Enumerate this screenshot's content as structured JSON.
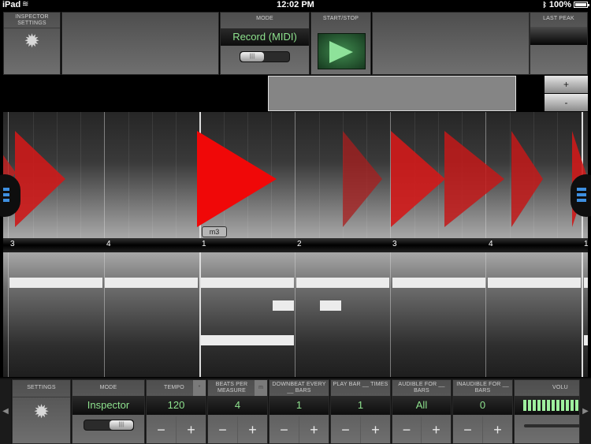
{
  "status_bar": {
    "device": "iPad",
    "time": "12:02 PM",
    "battery": "100%"
  },
  "top_panels": {
    "inspector_settings": {
      "label": "INSPECTOR SETTINGS",
      "icon": "gear-icon"
    },
    "mode": {
      "label": "MODE",
      "value": "Record (MIDI)",
      "toggle_state": "off"
    },
    "start_stop": {
      "label": "START/STOP",
      "icon": "play-icon"
    },
    "last_peak": {
      "label": "LAST PEAK",
      "value": ""
    }
  },
  "zoom_buttons": {
    "plus": "+",
    "minus": "-"
  },
  "timeline": {
    "marker_label": "m3",
    "ruler_numbers": [
      "3",
      "4",
      "1",
      "2",
      "3",
      "4",
      "1"
    ],
    "colors": {
      "triangle": "#e01010",
      "note": "#ececec"
    }
  },
  "bottom_panels": {
    "settings": {
      "label": "SETTINGS",
      "icon": "gear-icon"
    },
    "mode": {
      "label": "MODE",
      "value": "Inspector",
      "toggle_state": "on"
    },
    "tempo": {
      "label": "TEMPO",
      "value": "120",
      "minus": "−",
      "plus": "+"
    },
    "beats_per_measure": {
      "label": "BEATS PER MEASURE",
      "value": "4",
      "minus": "−",
      "plus": "+"
    },
    "downbeat": {
      "label": "DOWNBEAT EVERY __ BARS",
      "value": "1",
      "minus": "−",
      "plus": "+"
    },
    "play_bar": {
      "label": "PLAY BAR __ TIMES",
      "value": "1",
      "minus": "−",
      "plus": "+"
    },
    "audible": {
      "label": "AUDIBLE FOR __ BARS",
      "value": "All",
      "minus": "−",
      "plus": "+"
    },
    "inaudible": {
      "label": "INAUDIBLE FOR __ BARS",
      "value": "0",
      "minus": "−",
      "plus": "+"
    },
    "volume": {
      "label": "VOLU",
      "meter_level": 1.0,
      "segments": 12
    }
  },
  "nav": {
    "left_arrow": "◀",
    "right_arrow": "▶"
  }
}
